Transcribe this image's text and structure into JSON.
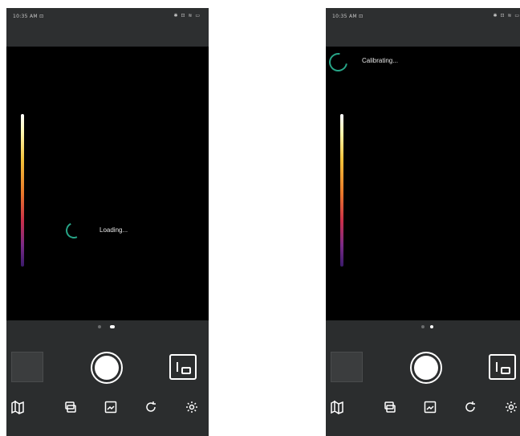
{
  "screens": [
    {
      "status_time": "10:35 AM ⊡",
      "status_icons": "✱ ⊡ ≋ ▭",
      "overlay_text": "Loading..."
    },
    {
      "status_time": "10:35 AM ⊡",
      "status_icons": "✱ ⊡ ≋ ▭",
      "overlay_text": "Calibrating..."
    }
  ],
  "icons": {
    "toolbar": [
      "map-icon",
      "layers-icon",
      "image-edit-icon",
      "rotate-icon",
      "settings-icon"
    ],
    "capture": [
      "gallery-thumbnail",
      "shutter-button",
      "picture-in-picture-icon"
    ]
  },
  "colors": {
    "background": "#2b2d2e",
    "viewer": "#000000",
    "accent_spinner": "#27a587",
    "text": "#e6e6e6"
  },
  "page_indicator": {
    "count": 2,
    "active_index": 1
  }
}
